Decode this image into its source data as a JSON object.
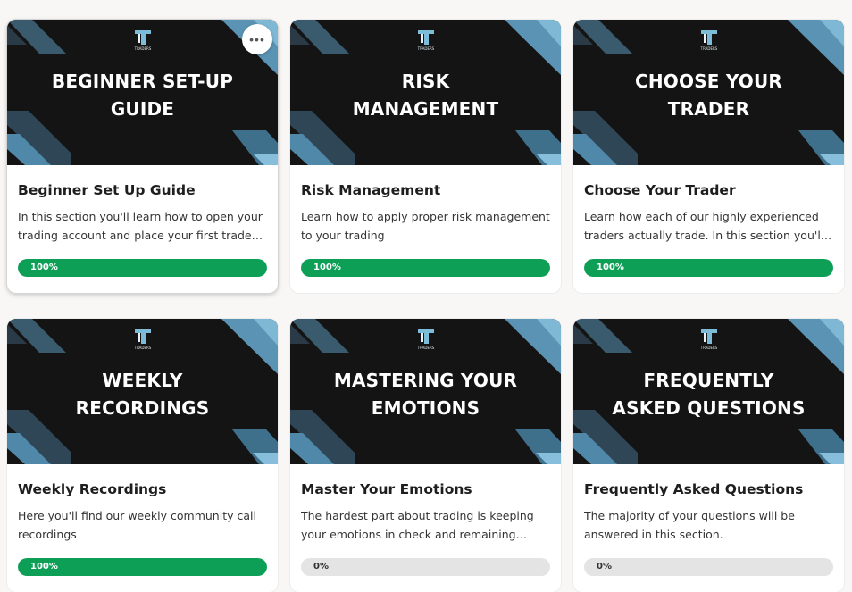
{
  "courses": [
    {
      "banner": "BEGINNER SET-UP\nGUIDE",
      "title": "Beginner Set Up Guide",
      "description": "In this section you'll learn how to open your trading account and place your first trade in...",
      "progress_label": "100%",
      "progress": 1.0,
      "active": true
    },
    {
      "banner": "RISK\nMANAGEMENT",
      "title": "Risk Management",
      "description": "Learn how to apply proper risk management to your trading",
      "progress_label": "100%",
      "progress": 1.0,
      "active": false
    },
    {
      "banner": "CHOOSE YOUR\nTRADER",
      "title": "Choose Your Trader",
      "description": "Learn how each of our highly experienced traders actually trade. In this section you'll b...",
      "progress_label": "100%",
      "progress": 1.0,
      "active": false
    },
    {
      "banner": "WEEKLY\nRECORDINGS",
      "title": "Weekly Recordings",
      "description": "Here you'll find our weekly community call recordings",
      "progress_label": "100%",
      "progress": 1.0,
      "active": false
    },
    {
      "banner": "MASTERING YOUR\nEMOTIONS",
      "title": "Master Your Emotions",
      "description": "The hardest part about trading is keeping your emotions in check and remaining calm...",
      "progress_label": "0%",
      "progress": 0.0,
      "active": false
    },
    {
      "banner": "FREQUENTLY\nASKED QUESTIONS",
      "title": "Frequently Asked Questions",
      "description": "The majority of your questions will be answered in this section.",
      "progress_label": "0%",
      "progress": 0.0,
      "active": false
    }
  ],
  "logo_text": "TRADERS",
  "more_button_glyph": "•••",
  "colors": {
    "progress_fill": "#0e9f57",
    "progress_track": "#e4e4e4",
    "banner_bg": "#141414",
    "accent_blue": "#4fa3c7",
    "accent_steel": "#3c5566"
  }
}
